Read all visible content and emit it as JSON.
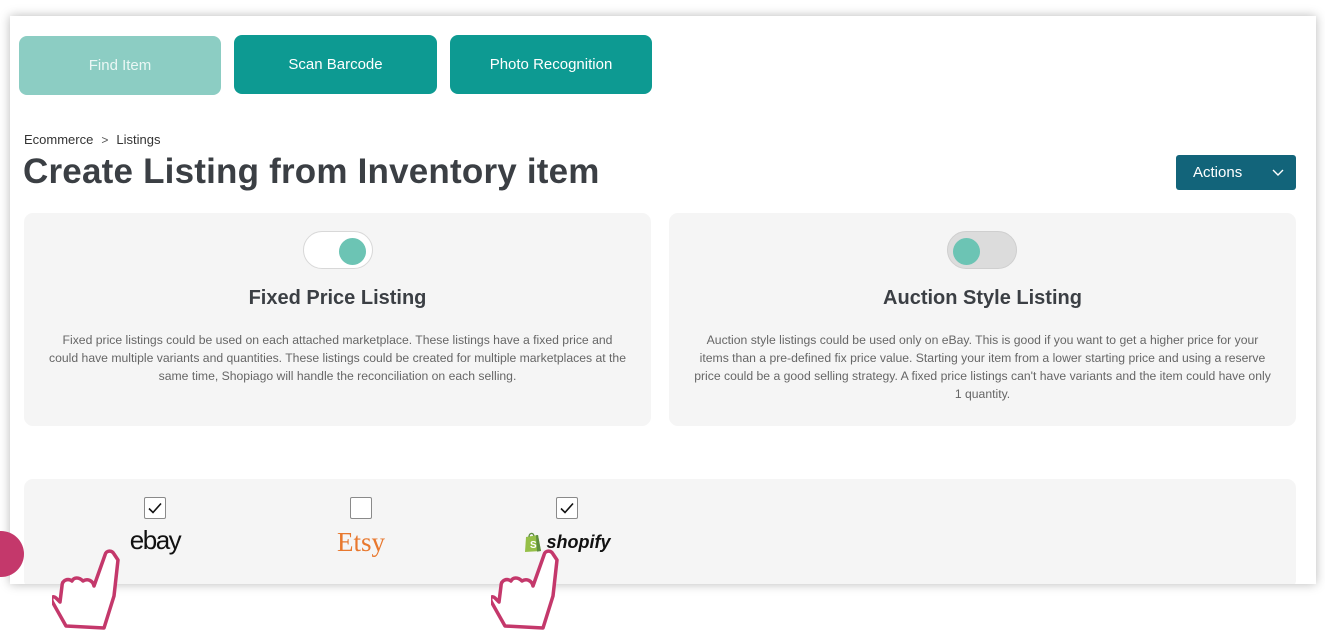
{
  "toolbar": {
    "find_item_label": "Find Item",
    "scan_barcode_label": "Scan Barcode",
    "photo_recognition_label": "Photo Recognition"
  },
  "breadcrumb": {
    "items": [
      "Ecommerce",
      "Listings"
    ],
    "separator": ">"
  },
  "page": {
    "title": "Create Listing from Inventory item",
    "actions_label": "Actions"
  },
  "listing_types": [
    {
      "title": "Fixed Price Listing",
      "enabled": true,
      "description": "Fixed price listings could be used on each attached marketplace. These listings have a fixed price and could have multiple variants and quantities. These listings could be created for multiple marketplaces at the same time, Shopiago will handle the reconciliation on each selling."
    },
    {
      "title": "Auction Style Listing",
      "enabled": false,
      "description": "Auction style listings could be used only on eBay. This is good if you want to get a higher price for your items than a pre-defined fix price value. Starting your item from a lower starting price and using a reserve price could be a good selling strategy. A fixed price listings can't have variants and the item could have only 1 quantity."
    }
  ],
  "marketplaces": [
    {
      "name": "ebay",
      "checked": true
    },
    {
      "name": "Etsy",
      "checked": false
    },
    {
      "name": "shopify",
      "checked": true
    }
  ],
  "colors": {
    "teal_button": "#0d9a92",
    "teal_button_disabled": "#8ccdc3",
    "actions_button": "#12647a",
    "toggle_knob": "#6cc4b4",
    "etsy_orange": "#e8782e",
    "shopify_green": "#95bf47",
    "cursor_pink": "#c4386b"
  }
}
